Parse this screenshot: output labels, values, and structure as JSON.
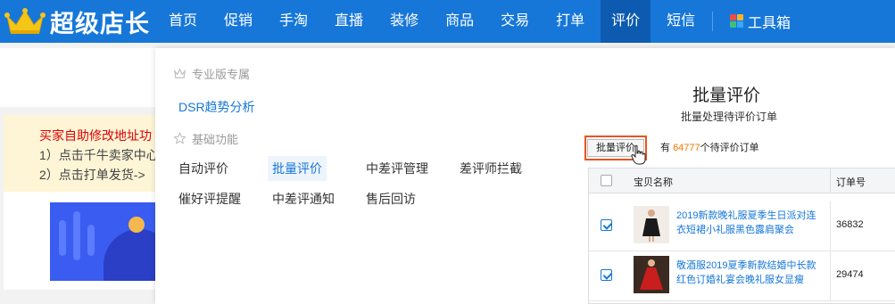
{
  "app": {
    "name": "超级店长"
  },
  "nav": {
    "items": [
      "首页",
      "促销",
      "手淘",
      "直播",
      "装修",
      "商品",
      "交易",
      "打单",
      "评价",
      "短信"
    ],
    "active_index": 8,
    "toolbox_label": "工具箱"
  },
  "background": {
    "notice_line1": "买家自助修改地址功",
    "notice_line2": "1）点击千牛卖家中心",
    "notice_line3": "2）点击打单发货->"
  },
  "dropdown": {
    "pro_section_title": "专业版专属",
    "pro_items": [
      "DSR趋势分析"
    ],
    "basic_section_title": "基础功能",
    "basic_items_row1": [
      "自动评价",
      "批量评价",
      "中差评管理",
      "差评师拦截"
    ],
    "basic_items_row2": [
      "催好评提醒",
      "中差评通知",
      "售后回访"
    ],
    "active_item": "批量评价"
  },
  "preview": {
    "title": "批量评价",
    "subtitle": "批量处理待评价订单",
    "button_label": "批量评价",
    "count_prefix": "有 ",
    "count_value": "64777",
    "count_suffix": "个待评价订单",
    "table": {
      "col_product": "宝贝名称",
      "col_order": "订单号",
      "rows": [
        {
          "name": "2019新款晚礼服夏季生日派对连衣短裙小礼服黑色露肩聚会",
          "order": "36832",
          "checked": true
        },
        {
          "name": "敬酒服2019夏季新款结婚中长款红色订婚礼宴会晚礼服女显瘦",
          "order": "29474",
          "checked": true
        }
      ]
    }
  },
  "colors": {
    "brand": "#1677d9",
    "nav_active": "#0d5bb0",
    "highlight": "#e8541e",
    "count": "#f07800"
  }
}
